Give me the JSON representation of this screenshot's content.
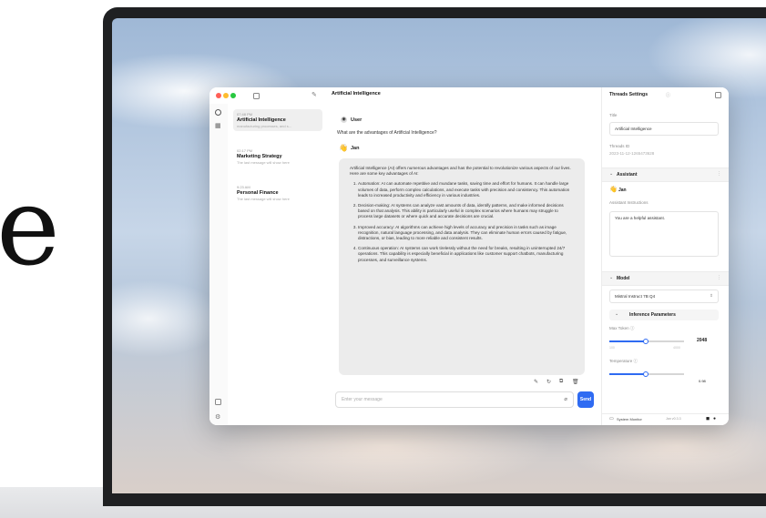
{
  "hero": {
    "letter": "e"
  },
  "window": {
    "title": "Artificial Intelligence",
    "threads": [
      {
        "time": "07:48 PM",
        "name": "Artificial Intelligence",
        "preview": "manufacturing processes, and s..."
      },
      {
        "time": "02:17 PM",
        "name": "Marketing Strategy",
        "preview": "The last message will show here"
      },
      {
        "time": "9:23 AM",
        "name": "Personal Finance",
        "preview": "The last message will show here"
      }
    ],
    "chat": {
      "user_label": "User",
      "user_message": "What are the advantages of Artificial Intelligence?",
      "bot_label": "Jan",
      "bot_emoji": "👋",
      "intro": "Artificial Intelligence (AI) offers numerous advantages and has the potential to revolutionize various aspects of our lives. Here are some key advantages of AI:",
      "points": [
        "Automation: AI can automate repetitive and mundane tasks, saving time and effort for humans. It can handle large volumes of data, perform complex calculations, and execute tasks with precision and consistency. This automation leads to increased productivity and efficiency in various industries.",
        "Decision-making: AI systems can analyze vast amounts of data, identify patterns, and make informed decisions based on that analysis. This ability is particularly useful in complex scenarios where humans may struggle to process large datasets or where quick and accurate decisions are crucial.",
        "Improved accuracy: AI algorithms can achieve high levels of accuracy and precision in tasks such as image recognition, natural language processing, and data analysis. They can eliminate human errors caused by fatigue, distractions, or bias, leading to more reliable and consistent results.",
        "Continuous operation: AI systems can work tirelessly without the need for breaks, resulting in uninterrupted 24/7 operations. This capability is especially beneficial in applications like customer support chatbots, manufacturing processes, and surveillance systems."
      ],
      "input_placeholder": "Enter your message",
      "send_label": "Send"
    },
    "settings": {
      "header": "Threads Settings",
      "title_label": "Title",
      "title_value": "Artificial Intelligence",
      "thread_id_label": "Threads ID",
      "thread_id_value": "2023-11-12-1265473628",
      "assistant_section": "Assistant",
      "assistant_name": "Jan",
      "assistant_emoji": "👋",
      "instructions_label": "Assistant Instructions",
      "instructions_value": "You are a helpful assistant.",
      "model_section": "Model",
      "model_value": "Mistral Instruct 7B Q4",
      "inference_section": "Inference Parameters",
      "max_token_label": "Max Token ⓘ",
      "max_token_min": "100",
      "max_token_max": "4000",
      "max_token_value": "2048",
      "temperature_label": "Temperature ⓘ",
      "temperature_value": "0.98",
      "system_monitor": "System Monitor",
      "version": "Jan v0.3.3"
    }
  }
}
